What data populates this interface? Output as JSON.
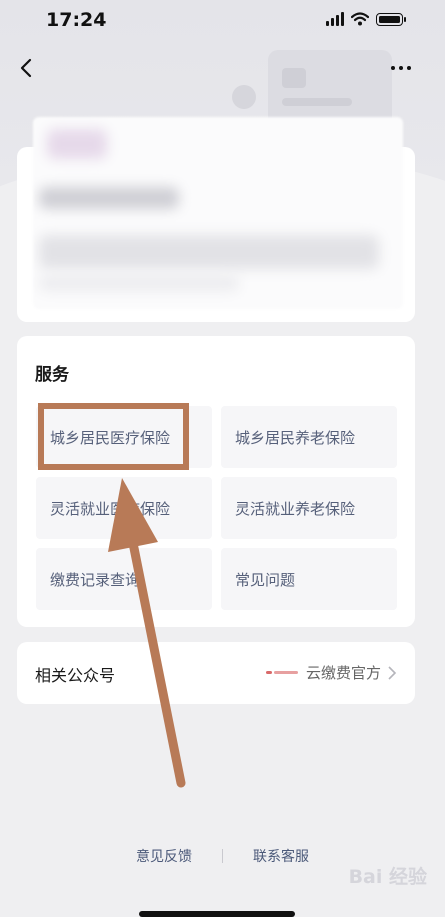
{
  "status_bar": {
    "time": "17:24"
  },
  "service": {
    "title": "服务",
    "items": [
      {
        "label": "城乡居民医疗保险"
      },
      {
        "label": "城乡居民养老保险"
      },
      {
        "label": "灵活就业医疗保险"
      },
      {
        "label": "灵活就业养老保险"
      },
      {
        "label": "缴费记录查询"
      },
      {
        "label": "常见问题"
      }
    ]
  },
  "public_account": {
    "label": "相关公众号",
    "value": "云缴费官方"
  },
  "footer": {
    "feedback": "意见反馈",
    "support": "联系客服"
  },
  "watermark": {
    "text": "Bai 经验"
  },
  "colors": {
    "highlight": "#b87a57",
    "link": "#4c5a7a",
    "service_text": "#56607a"
  }
}
